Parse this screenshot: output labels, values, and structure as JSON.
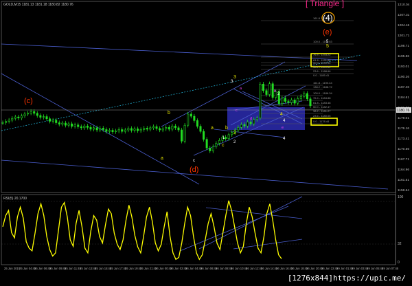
{
  "header": {
    "symbol_info": "GOLD,M15  1181.13  1181.18  1180.82  1180.76",
    "triangle_label": "[ Triangle ]",
    "wave_title": "(4)"
  },
  "watermark": "[1276x844]https://upic.me/",
  "chart_data": [
    {
      "type": "line",
      "title": "GOLD,M15",
      "ylim": [
        1158.64,
        1210.04
      ],
      "y_ticks": [
        "1210.04",
        "1207.31",
        "1204.46",
        "1201.71",
        "1198.71",
        "1195.86",
        "1193.01",
        "1190.26",
        "1187.46",
        "1184.61",
        "1181.86",
        "1179.01",
        "1176.16",
        "1173.41",
        "1170.56",
        "1167.71",
        "1164.96",
        "1161.51",
        "1158.64"
      ],
      "current_price": "1180.76",
      "x_tick_labels": [
        "25 Jun 2015",
        "25 Jun 04:45",
        "25 Jun 06:45",
        "25 Jun 09:45",
        "25 Jun 11:45",
        "25 Jun 13:45",
        "25 Jun 15:45",
        "25 Jun 17:45",
        "25 Jun 19:45",
        "25 Jun 21:45",
        "26 Jun 00:45",
        "26 Jun 02:45",
        "26 Jun 04:45",
        "26 Jun 06:45",
        "26 Jun 08:45",
        "26 Jun 10:45",
        "26 Jun 12:45",
        "26 Jun 14:45",
        "26 Jun 16:45",
        "26 Jun 18:45",
        "26 Jun 20:45",
        "26 Jun 22:45",
        "29 Jun 01:45",
        "29 Jun 03:45",
        "29 Jun 05:45",
        "29 Jun 07:45"
      ],
      "series": [
        {
          "name": "GOLD,M15",
          "values": [
            1177.2,
            1177.6,
            1177.9,
            1178.4,
            1178.8,
            1178.5,
            1179.1,
            1179.6,
            1179.9,
            1180.3,
            1179.8,
            1179.2,
            1178.7,
            1178.9,
            1178.3,
            1177.6,
            1177.9,
            1177.2,
            1176.8,
            1177.1,
            1176.5,
            1176.9,
            1176.2,
            1176.6,
            1176.1,
            1175.8,
            1176.3,
            1175.9,
            1175.4,
            1175.8,
            1175.2,
            1175.7,
            1175.3,
            1174.8,
            1175.1,
            1174.7,
            1174.9,
            1175.3,
            1174.8,
            1175.2,
            1175.6,
            1175.1,
            1175.5,
            1175.0,
            1175.3,
            1175.7,
            1175.4,
            1175.8,
            1176.1,
            1175.6,
            1175.2,
            1175.5,
            1175.9,
            1175.4,
            1176.3,
            1175.8,
            1175.2,
            1172.1,
            1176.5,
            1179.6,
            1179.0,
            1177.8,
            1176.2,
            1174.8,
            1172.6,
            1170.2,
            1169.4,
            1170.6,
            1171.5,
            1172.3,
            1173.2,
            1172.8,
            1173.9,
            1174.5,
            1175.2,
            1175.9,
            1176.7,
            1176.3,
            1177.4,
            1176.9,
            1178.1,
            1178.5,
            1187.9,
            1186.1,
            1185.0,
            1188.0,
            1184.2,
            1185.9,
            1182.5,
            1184.0,
            1183.1,
            1182.8,
            1183.5,
            1182.6,
            1183.9,
            1184.5,
            1185.3,
            1183.8,
            1181.9
          ]
        },
        {
          "name": "RSI(5) 20.1700",
          "values": [
            55,
            72,
            80,
            46,
            38,
            70,
            85,
            68,
            32,
            22,
            18,
            45,
            75,
            90,
            72,
            40,
            20,
            10,
            15,
            50,
            85,
            92,
            70,
            35,
            25,
            60,
            80,
            55,
            22,
            15,
            48,
            72,
            65,
            40,
            30,
            58,
            82,
            75,
            45,
            28,
            20,
            35,
            65,
            88,
            70,
            42,
            24,
            15,
            40,
            70,
            85,
            62,
            30,
            18,
            28,
            55,
            78,
            40,
            15,
            5,
            8,
            30,
            60,
            85,
            72,
            40,
            15,
            5,
            12,
            35,
            60,
            75,
            55,
            30,
            20,
            45,
            72,
            95,
            80,
            55,
            30,
            15,
            25,
            60,
            85,
            70,
            45,
            22,
            15,
            40,
            75,
            90,
            65,
            35,
            12,
            6
          ]
        }
      ],
      "rsi": {
        "label": "RSI(5) 20.1700",
        "ylim": [
          0,
          100
        ],
        "ticks": [
          "100",
          "32",
          "0"
        ]
      },
      "fib_labels": [
        "161.8 - 1203.13",
        "100.0 - 1196.53",
        "76.4 - 1193.22",
        "61.8 - 1191.68",
        "50.0 - 1190.94",
        "38.2 - 1189.82",
        "23.6 - 1188.66",
        "0.0 - 1185.41",
        "161.8 - 1190.44",
        "138.2 - 1188.72",
        "100.0 - 1186.34",
        "76.4 - 1184.88",
        "61.8 - 1183.48",
        "50.0 - 1182.47",
        "38.2 - 1181.27",
        "23.6 - 1180.05",
        "0.0 - 1178.44"
      ],
      "wave_labels": {
        "yellow": [
          "a",
          "b",
          "c",
          "a",
          "b",
          "2",
          "3",
          "4",
          "5"
        ],
        "orange": [
          "(c)",
          "(d)",
          "(e)",
          "(4)"
        ],
        "white": [
          "c",
          "1",
          "2",
          "3",
          "4",
          "5",
          "2",
          "4"
        ],
        "magenta": [
          "a",
          "b",
          "c",
          "d",
          "e"
        ]
      },
      "colors": {
        "background": "#000000",
        "candles": "#22dd22",
        "rsi_line": "#ffff00",
        "trend_lines": "#4a5ecf",
        "dotted_trend": "#1fa6c8",
        "highlight_box": "#2b2bb0",
        "target_box": "#ffff00",
        "triangle_label": "#ff2a8f",
        "wave_orange": "#ff3300",
        "wave_yellow": "#e6e600"
      }
    }
  ]
}
